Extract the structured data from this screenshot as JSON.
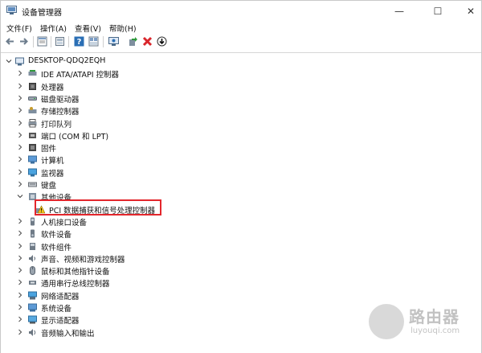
{
  "window": {
    "title": "设备管理器",
    "minimize_glyph": "—",
    "maximize_glyph": "☐",
    "close_glyph": "✕"
  },
  "menu": [
    {
      "label": "文件(F)"
    },
    {
      "label": "操作(A)"
    },
    {
      "label": "查看(V)"
    },
    {
      "label": "帮助(H)"
    }
  ],
  "toolbar": [
    "back-arrow-icon",
    "forward-arrow-icon",
    "properties-icon",
    "show-hidden-icon",
    "help-icon",
    "view-icon",
    "monitor-scan-icon",
    "update-driver-icon",
    "uninstall-x-icon",
    "disable-download-icon"
  ],
  "tree": {
    "root": "DESKTOP-QDQ2EQH",
    "items": [
      {
        "label": "IDE ATA/ATAPI 控制器",
        "icon": "ide-controller-icon",
        "expanded": false
      },
      {
        "label": "处理器",
        "icon": "processor-icon",
        "expanded": false
      },
      {
        "label": "磁盘驱动器",
        "icon": "disk-drive-icon",
        "expanded": false
      },
      {
        "label": "存储控制器",
        "icon": "storage-controller-icon",
        "expanded": false
      },
      {
        "label": "打印队列",
        "icon": "print-queue-icon",
        "expanded": false
      },
      {
        "label": "端口 (COM 和 LPT)",
        "icon": "port-icon",
        "expanded": false
      },
      {
        "label": "固件",
        "icon": "firmware-icon",
        "expanded": false
      },
      {
        "label": "计算机",
        "icon": "computer-icon",
        "expanded": false
      },
      {
        "label": "监视器",
        "icon": "monitor-icon",
        "expanded": false
      },
      {
        "label": "键盘",
        "icon": "keyboard-icon",
        "expanded": false
      },
      {
        "label": "其他设备",
        "icon": "other-devices-icon",
        "expanded": true,
        "children": [
          {
            "label": "PCI 数据捕获和信号处理控制器",
            "icon": "warning-device-icon"
          }
        ]
      },
      {
        "label": "人机接口设备",
        "icon": "hid-icon",
        "expanded": false
      },
      {
        "label": "软件设备",
        "icon": "software-device-icon",
        "expanded": false
      },
      {
        "label": "软件组件",
        "icon": "software-component-icon",
        "expanded": false
      },
      {
        "label": "声音、视频和游戏控制器",
        "icon": "sound-icon",
        "expanded": false
      },
      {
        "label": "鼠标和其他指针设备",
        "icon": "mouse-icon",
        "expanded": false
      },
      {
        "label": "通用串行总线控制器",
        "icon": "usb-icon",
        "expanded": false
      },
      {
        "label": "网络适配器",
        "icon": "network-adapter-icon",
        "expanded": false
      },
      {
        "label": "系统设备",
        "icon": "system-device-icon",
        "expanded": false
      },
      {
        "label": "显示适配器",
        "icon": "display-adapter-icon",
        "expanded": false
      },
      {
        "label": "音频输入和输出",
        "icon": "audio-io-icon",
        "expanded": false
      }
    ]
  },
  "watermark": {
    "brand": "路由器",
    "url": "luyouqi.com"
  },
  "colors": {
    "highlight": "#e3262c",
    "accent": "#2b6fb5"
  }
}
